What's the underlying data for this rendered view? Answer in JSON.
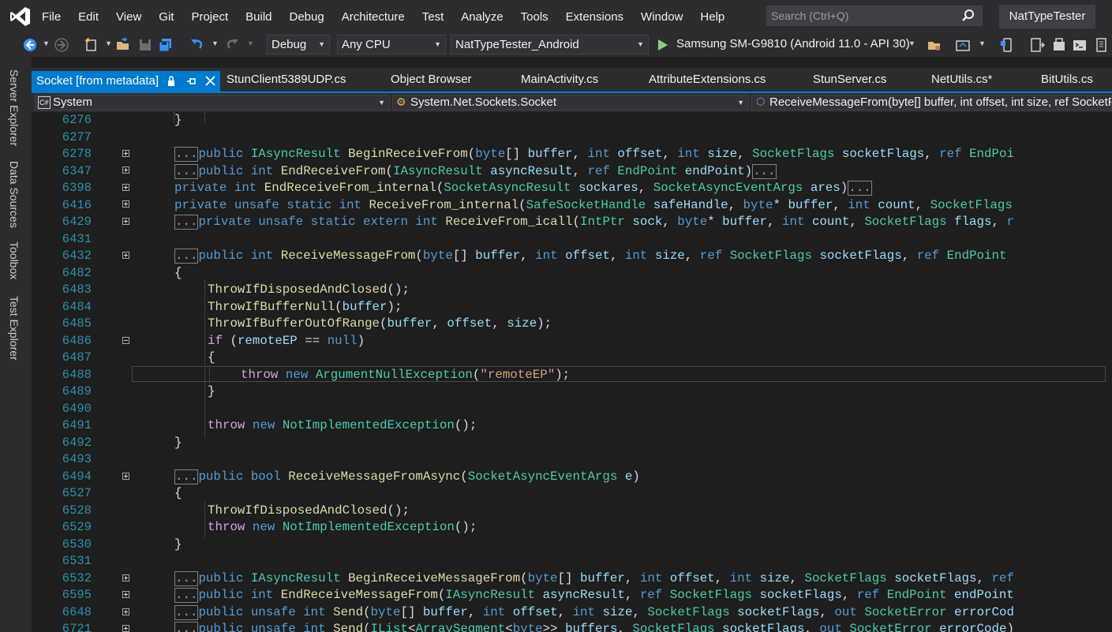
{
  "menu": {
    "items": [
      "File",
      "Edit",
      "View",
      "Git",
      "Project",
      "Build",
      "Debug",
      "Architecture",
      "Test",
      "Analyze",
      "Tools",
      "Extensions",
      "Window",
      "Help"
    ],
    "search_placeholder": "Search (Ctrl+Q)",
    "solution_name": "NatTypeTester"
  },
  "toolbar": {
    "config": "Debug",
    "platform": "Any CPU",
    "startup_project": "NatTypeTester_Android",
    "run_target": "Samsung SM-G9810 (Android 11.0 - API 30)"
  },
  "side_tabs": [
    "Server Explorer",
    "Data Sources",
    "Toolbox",
    "Test Explorer"
  ],
  "tabs": {
    "active": "Socket [from metadata]",
    "others": [
      "StunClient5389UDP.cs",
      "Object Browser",
      "MainActivity.cs",
      "AttributeExtensions.cs",
      "StunServer.cs",
      "NetUtils.cs*",
      "BitUtils.cs"
    ]
  },
  "navbar": {
    "project": "System",
    "type": "System.Net.Sockets.Socket",
    "member": "ReceiveMessageFrom(byte[] buffer, int offset, int size, ref SocketFlags socketFlags, ref EndPoint remoteEP, out IPPacketInformation ipPacketInformation)"
  },
  "editor": {
    "line_numbers": [
      "6276",
      "6277",
      "6278",
      "6347",
      "6398",
      "6416",
      "6429",
      "6431",
      "6432",
      "6482",
      "6483",
      "6484",
      "6485",
      "6486",
      "6487",
      "6488",
      "6489",
      "6490",
      "6491",
      "6492",
      "6493",
      "6494",
      "6527",
      "6528",
      "6529",
      "6530",
      "6531",
      "6532",
      "6595",
      "6648",
      "6721"
    ],
    "collapsed_marker": "..."
  },
  "colors": {
    "accent": "#007acc",
    "keyword": "#569cd6",
    "control_keyword": "#d8a0df",
    "type": "#4ec9b0",
    "method": "#dcdcaa",
    "parameter": "#9cdcfe",
    "string": "#d69d85",
    "line_number": "#2b91af"
  }
}
